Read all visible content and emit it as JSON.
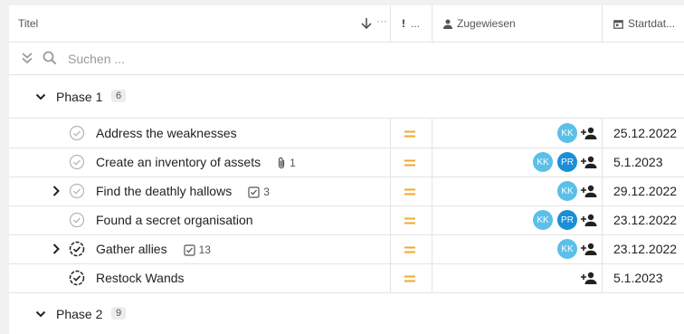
{
  "header": {
    "title_col": "Titel",
    "priority_col": "!",
    "priority_more": "...",
    "assigned_col": "Zugewiesen",
    "start_col": "Startdat..."
  },
  "search": {
    "placeholder": "Suchen ..."
  },
  "groups": [
    {
      "name": "Phase 1",
      "count": "6"
    },
    {
      "name": "Phase 2",
      "count": "9"
    }
  ],
  "tasks": [
    {
      "title": "Address the weaknesses",
      "meta": "",
      "meta_icon": "",
      "status": "open",
      "expand": false,
      "assignees": [
        "KK"
      ],
      "start": "25.12.2022"
    },
    {
      "title": "Create an inventory of assets",
      "meta": "1",
      "meta_icon": "paperclip-icon",
      "status": "open",
      "expand": false,
      "assignees": [
        "KK",
        "PR"
      ],
      "start": "5.1.2023"
    },
    {
      "title": "Find the deathly hallows",
      "meta": "3",
      "meta_icon": "checklist-icon",
      "status": "open",
      "expand": true,
      "assignees": [
        "KK"
      ],
      "start": "29.12.2022"
    },
    {
      "title": "Found a secret organisation",
      "meta": "",
      "meta_icon": "",
      "status": "open",
      "expand": false,
      "assignees": [
        "KK",
        "PR"
      ],
      "start": "23.12.2022"
    },
    {
      "title": "Gather allies",
      "meta": "13",
      "meta_icon": "checklist-icon",
      "status": "in-progress",
      "expand": true,
      "assignees": [
        "KK"
      ],
      "start": "23.12.2022"
    },
    {
      "title": "Restock Wands",
      "meta": "",
      "meta_icon": "",
      "status": "in-progress",
      "expand": false,
      "assignees": [],
      "start": "5.1.2023"
    }
  ],
  "colors": {
    "kk": "#5bbfe8",
    "pr": "#1a8fd6",
    "priority": "#f0a830",
    "icon": "#222222"
  }
}
